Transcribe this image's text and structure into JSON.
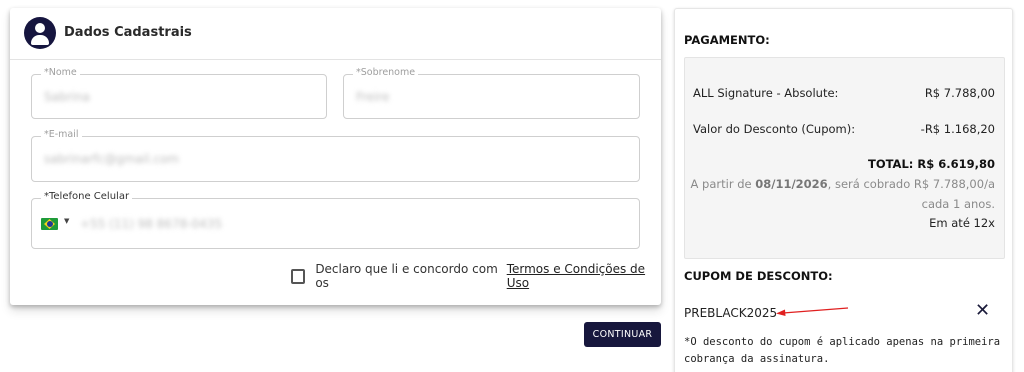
{
  "form": {
    "title": "Dados Cadastrais",
    "fields": {
      "nome": {
        "label": "*Nome",
        "value": "Sabrina"
      },
      "sobrenome": {
        "label": "*Sobrenome",
        "value": "Freire"
      },
      "email": {
        "label": "*E-mail",
        "value": "sabrinarfc@gmail.com"
      },
      "telefone": {
        "label": "*Telefone Celular",
        "value": "+55 (11) 98 8678-0435"
      }
    },
    "terms": {
      "text": "Declaro que li e concordo com os",
      "link": "Termos e Condições de Uso"
    },
    "continue_label": "CONTINUAR"
  },
  "payment": {
    "title": "PAGAMENTO:",
    "product_name": "ALL Signature - Absolute:",
    "product_price": "R$ 7.788,00",
    "discount_label": "Valor do Desconto (Cupom):",
    "discount_value": "-R$ 1.168,20",
    "total": "TOTAL: R$ 6.619,80",
    "renewal_prefix": "A partir de",
    "renewal_date": "08/11/2026",
    "renewal_suffix": ", será cobrado R$ 7.788,00/a",
    "renewal_line2": "cada 1 anos.",
    "installments": "Em até 12x"
  },
  "coupon": {
    "title": "CUPOM DE DESCONTO:",
    "code": "PREBLACK2025",
    "note": "*O desconto do cupom é aplicado apenas na primeira cobrança da assinatura."
  },
  "colors": {
    "primary": "#17173d",
    "arrow": "#e02020"
  },
  "icons": {
    "avatar": "account-circle-icon",
    "remove": "close-icon",
    "flag": "brazil-flag-icon"
  }
}
